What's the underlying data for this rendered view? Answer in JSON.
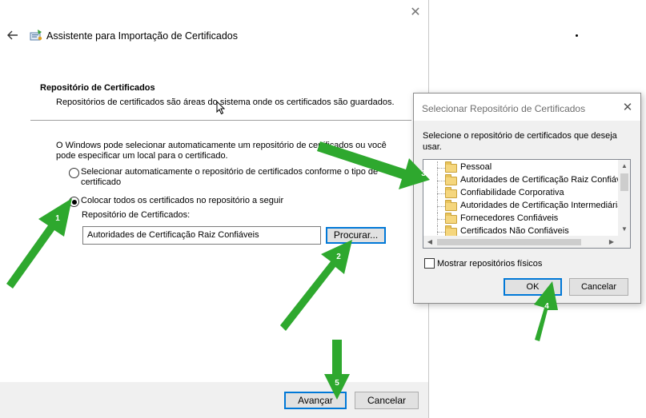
{
  "wizard": {
    "title": "Assistente para Importação de Certificados",
    "section_heading": "Repositório de Certificados",
    "section_description": "Repositórios de certificados são áreas do sistema onde os certificados são guardados.",
    "info_text": "O Windows pode selecionar automaticamente um repositório de certificados ou você pode especificar um local para o certificado.",
    "option_auto": "Selecionar automaticamente o repositório de certificados conforme o tipo de certificado",
    "option_manual": "Colocar todos os certificados no repositório a seguir",
    "selected_option": "manual",
    "store_label": "Repositório de Certificados:",
    "store_value": "Autoridades de Certificação Raiz Confiáveis",
    "browse_label": "Procurar...",
    "next_label": "Avançar",
    "cancel_label": "Cancelar"
  },
  "dialog": {
    "title": "Selecionar Repositório de Certificados",
    "prompt": "Selecione o repositório de certificados que deseja usar.",
    "tree_items": [
      {
        "label": "Pessoal"
      },
      {
        "label": "Autoridades de Certificação Raiz Confiáveis"
      },
      {
        "label": "Confiabilidade Corporativa"
      },
      {
        "label": "Autoridades de Certificação Intermediárias"
      },
      {
        "label": "Fornecedores Confiáveis"
      },
      {
        "label": "Certificados Não Confiáveis"
      }
    ],
    "show_physical_label": "Mostrar repositórios físicos",
    "show_physical_checked": false,
    "ok_label": "OK",
    "cancel_label": "Cancelar"
  },
  "annotations": {
    "step_numbers": [
      "1",
      "2",
      "3",
      "4",
      "5"
    ],
    "arrow_color": "#2ea82e"
  },
  "icons": {
    "back": "back-arrow-icon",
    "app": "certificate-wizard-icon",
    "close": "close-icon",
    "folder": "folder-icon"
  }
}
